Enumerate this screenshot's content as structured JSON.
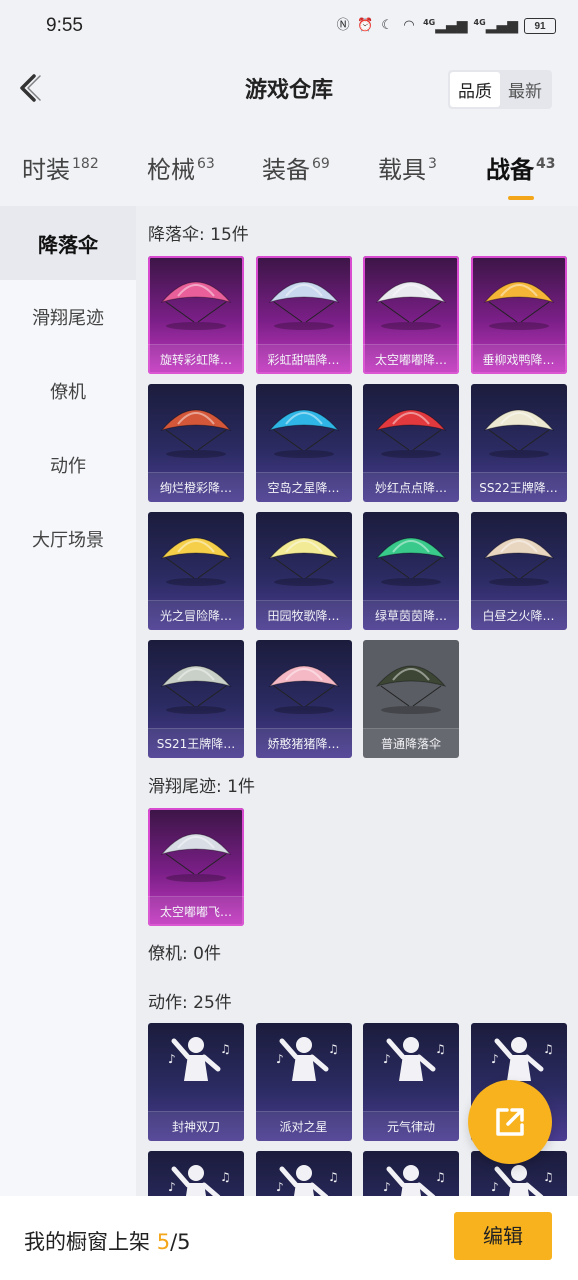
{
  "status_bar": {
    "time": "9:55",
    "battery": "91",
    "net1": "4G",
    "net2": "4G"
  },
  "header": {
    "title": "游戏仓库",
    "sort_quality": "品质",
    "sort_newest": "最新"
  },
  "tabs": [
    {
      "label": "时装",
      "count": "182"
    },
    {
      "label": "枪械",
      "count": "63"
    },
    {
      "label": "装备",
      "count": "69"
    },
    {
      "label": "载具",
      "count": "3"
    },
    {
      "label": "战备",
      "count": "43"
    }
  ],
  "sidebar": [
    {
      "label": "降落伞"
    },
    {
      "label": "滑翔尾迹"
    },
    {
      "label": "僚机"
    },
    {
      "label": "动作"
    },
    {
      "label": "大厅场景"
    }
  ],
  "sections": {
    "parachute": {
      "title": "降落伞: 15件",
      "items": [
        {
          "name": "旋转彩虹降…",
          "color": "#e85f9a",
          "rarity": "pink"
        },
        {
          "name": "彩虹甜喵降…",
          "color": "#c9d8ef",
          "rarity": "pink"
        },
        {
          "name": "太空嘟嘟降…",
          "color": "#e9e9f0",
          "rarity": "pink"
        },
        {
          "name": "垂柳戏鸭降…",
          "color": "#f5b638",
          "rarity": "pink"
        },
        {
          "name": "绚烂橙彩降…",
          "color": "#d5573a",
          "rarity": "blue"
        },
        {
          "name": "空岛之星降…",
          "color": "#2fb6e6",
          "rarity": "blue"
        },
        {
          "name": "妙红点点降…",
          "color": "#e2393f",
          "rarity": "blue"
        },
        {
          "name": "SS22王牌降…",
          "color": "#ede8d2",
          "rarity": "blue"
        },
        {
          "name": "光之冒险降…",
          "color": "#f5cf4a",
          "rarity": "blue"
        },
        {
          "name": "田园牧歌降…",
          "color": "#f2ea94",
          "rarity": "blue"
        },
        {
          "name": "绿草茵茵降…",
          "color": "#38c98b",
          "rarity": "blue"
        },
        {
          "name": "白昼之火降…",
          "color": "#e9d6c1",
          "rarity": "blue"
        },
        {
          "name": "SS21王牌降…",
          "color": "#c9d0c7",
          "rarity": "blue"
        },
        {
          "name": "娇憨猪猪降…",
          "color": "#f5b9c6",
          "rarity": "blue"
        },
        {
          "name": "普通降落伞",
          "color": "#3d4634",
          "rarity": "gray"
        }
      ]
    },
    "glide_trail": {
      "title": "滑翔尾迹: 1件",
      "items": [
        {
          "name": "太空嘟嘟飞…",
          "color": "#d8dde6",
          "rarity": "pink"
        }
      ]
    },
    "wingman": {
      "title": "僚机: 0件"
    },
    "emote": {
      "title": "动作: 25件",
      "items": [
        {
          "name": "封神双刀"
        },
        {
          "name": "派对之星"
        },
        {
          "name": "元气律动"
        },
        {
          "name": ""
        },
        {
          "name": ""
        },
        {
          "name": ""
        },
        {
          "name": ""
        },
        {
          "name": ""
        }
      ]
    }
  },
  "bottom_bar": {
    "label": "我的橱窗上架",
    "current": "5",
    "total": "/5",
    "edit": "编辑"
  }
}
